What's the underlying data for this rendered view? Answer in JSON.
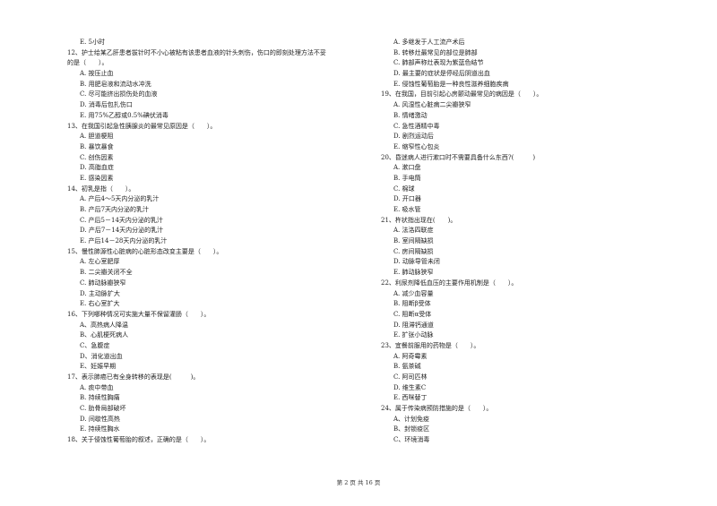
{
  "left_column": [
    {
      "type": "opt",
      "text": "E. 5小时"
    },
    {
      "type": "q",
      "text": "12、护士给某乙肝患者拔针时不小心被粘有该患者血液的针头刺伤，伤口的即刻处理方法不妥"
    },
    {
      "type": "cont",
      "text": "的是（　　）。"
    },
    {
      "type": "opt",
      "text": "A. 按压止血"
    },
    {
      "type": "opt",
      "text": "B. 用肥皂液和流动水冲洗"
    },
    {
      "type": "opt",
      "text": "C. 尽可能挤出损伤处的血液"
    },
    {
      "type": "opt",
      "text": "D. 消毒后包扎伤口"
    },
    {
      "type": "opt",
      "text": "E. 用75%乙醇或0.5%碘伏消毒"
    },
    {
      "type": "q",
      "text": "13、在我国引起急性胰腺炎的最常见原因是（　　）。"
    },
    {
      "type": "opt",
      "text": "A. 胆道梗阻"
    },
    {
      "type": "opt",
      "text": "B. 暴饮暴食"
    },
    {
      "type": "opt",
      "text": "C. 创伤因素"
    },
    {
      "type": "opt",
      "text": "D. 高脂血症"
    },
    {
      "type": "opt",
      "text": "E. 感染因素"
    },
    {
      "type": "q",
      "text": "14、初乳是指（　　）。"
    },
    {
      "type": "opt",
      "text": "A. 产后4～5天内分泌的乳汁"
    },
    {
      "type": "opt",
      "text": "B. 产后7天内分泌的乳汁"
    },
    {
      "type": "opt",
      "text": "C. 产后5－14天内分泌的乳汁"
    },
    {
      "type": "opt",
      "text": "D. 产后7－14天内分泌的乳汁"
    },
    {
      "type": "opt",
      "text": "E. 产后14－28天内分泌的乳汁"
    },
    {
      "type": "q",
      "text": "15、慢性肺源性心脏病的心脏形态改变主要是（　　）。"
    },
    {
      "type": "opt",
      "text": "A. 左心室肥厚"
    },
    {
      "type": "opt",
      "text": "B. 二尖瓣关闭不全"
    },
    {
      "type": "opt",
      "text": "C. 肺动脉瓣狭窄"
    },
    {
      "type": "opt",
      "text": "D. 主动脉扩大"
    },
    {
      "type": "opt",
      "text": "E. 右心室扩大"
    },
    {
      "type": "q",
      "text": "16、下列哪种情况可实施大量不保留灌肠（　　）。"
    },
    {
      "type": "opt",
      "text": "A、高热病人降温"
    },
    {
      "type": "opt",
      "text": "B、心肌梗死病人"
    },
    {
      "type": "opt",
      "text": "C、急腹症"
    },
    {
      "type": "opt",
      "text": "D、消化道出血"
    },
    {
      "type": "opt",
      "text": "E、妊娠早期"
    },
    {
      "type": "q",
      "text": "17、表示肺癌已有全身转移的表现是(　　　)。"
    },
    {
      "type": "opt",
      "text": "A. 痰中带血"
    },
    {
      "type": "opt",
      "text": "B. 持续性胸痛"
    },
    {
      "type": "opt",
      "text": "C. 肋骨局部破坏"
    },
    {
      "type": "opt",
      "text": "D. 间歇性高热"
    },
    {
      "type": "opt",
      "text": "E. 持续性胸水"
    },
    {
      "type": "q",
      "text": "18、关于侵蚀性葡萄胎的叙述，正确的是（　　）。"
    }
  ],
  "right_column": [
    {
      "type": "opt",
      "text": "A. 多继发于人工流产术后"
    },
    {
      "type": "opt",
      "text": "B. 转移灶最常见的部位是肺部"
    },
    {
      "type": "opt",
      "text": "C. 肺部声称灶表现为紫蓝色结节"
    },
    {
      "type": "opt",
      "text": "D. 最主要的症状是停经后阴道出血"
    },
    {
      "type": "opt",
      "text": "E. 侵蚀性葡萄胎是一种良性滋养细胞疾病"
    },
    {
      "type": "q",
      "text": "19、在我国，目前引起心房颤动最常见的病因是（　　）。"
    },
    {
      "type": "opt",
      "text": "A. 风湿性心脏病二尖瓣狭窄"
    },
    {
      "type": "opt",
      "text": "B. 情绪激动"
    },
    {
      "type": "opt",
      "text": "C. 急性酒精中毒"
    },
    {
      "type": "opt",
      "text": "D. 剧烈运动后"
    },
    {
      "type": "opt",
      "text": "E. 缩窄性心包炎"
    },
    {
      "type": "q",
      "text": "20、昏迷病人进行漱口时不需要具备什么东西?(　　　)"
    },
    {
      "type": "opt",
      "text": "A. 漱口盘"
    },
    {
      "type": "opt",
      "text": "B. 手电筒"
    },
    {
      "type": "opt",
      "text": "C. 棉球"
    },
    {
      "type": "opt",
      "text": "D. 开口器"
    },
    {
      "type": "opt",
      "text": "E. 吸水管"
    },
    {
      "type": "q",
      "text": "21、杵状指出现在(　　)。"
    },
    {
      "type": "opt",
      "text": "A. 法洛四联症"
    },
    {
      "type": "opt",
      "text": "B. 室间隔缺损"
    },
    {
      "type": "opt",
      "text": "C. 房间隔缺损"
    },
    {
      "type": "opt",
      "text": "D. 动脉导管未闭"
    },
    {
      "type": "opt",
      "text": "E. 肺动脉狭窄"
    },
    {
      "type": "q",
      "text": "22、利尿剂降低血压的主要作用机制是（　　）。"
    },
    {
      "type": "opt",
      "text": "A. 减少血容量"
    },
    {
      "type": "opt",
      "text": "B. 阻断β受体"
    },
    {
      "type": "opt",
      "text": "C. 阻断α受体"
    },
    {
      "type": "opt",
      "text": "D. 阻滞钙通道"
    },
    {
      "type": "opt",
      "text": "E. 扩张小动脉"
    },
    {
      "type": "q",
      "text": "23、宜餐前服用的药物是（　　）。"
    },
    {
      "type": "opt",
      "text": "A. 阿奇霉素"
    },
    {
      "type": "opt",
      "text": "B. 氨茶碱"
    },
    {
      "type": "opt",
      "text": "C. 阿司匹林"
    },
    {
      "type": "opt",
      "text": "D. 维生素C"
    },
    {
      "type": "opt",
      "text": "E. 西咪替丁"
    },
    {
      "type": "q",
      "text": "24、属于传染病预防措施的是（　　）。"
    },
    {
      "type": "opt",
      "text": "A、计划免疫"
    },
    {
      "type": "opt",
      "text": "B、封锁疫区"
    },
    {
      "type": "opt",
      "text": "C、环境消毒"
    }
  ],
  "footer": {
    "page_label": "第 2 页 共 16 页"
  }
}
